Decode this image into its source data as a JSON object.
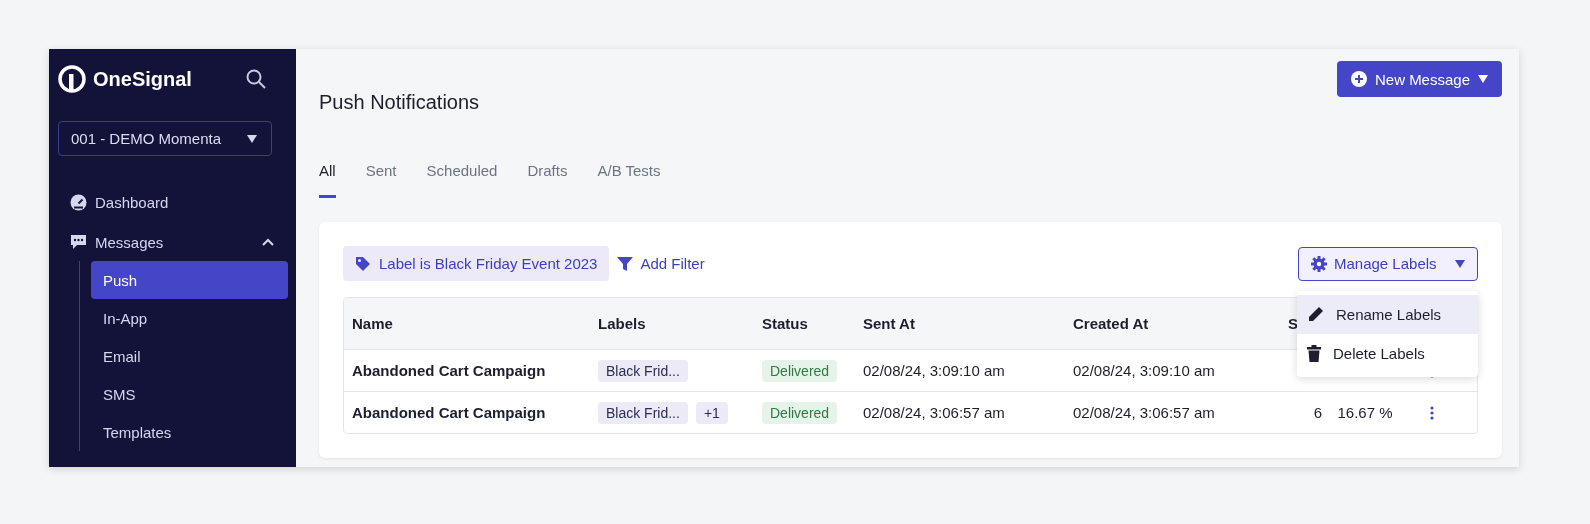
{
  "sidebar": {
    "brand": "OneSignal",
    "app_selector": "001 - DEMO Momenta",
    "nav": [
      {
        "label": "Dashboard"
      },
      {
        "label": "Messages",
        "expanded": true,
        "children": [
          {
            "label": "Push",
            "selected": true
          },
          {
            "label": "In-App",
            "selected": false
          },
          {
            "label": "Email",
            "selected": false
          },
          {
            "label": "SMS",
            "selected": false
          },
          {
            "label": "Templates",
            "selected": false
          }
        ]
      }
    ]
  },
  "header": {
    "title": "Push Notifications",
    "new_button": "New Message"
  },
  "tabs": [
    {
      "label": "All",
      "selected": true
    },
    {
      "label": "Sent",
      "selected": false
    },
    {
      "label": "Scheduled",
      "selected": false
    },
    {
      "label": "Drafts",
      "selected": false
    },
    {
      "label": "A/B Tests",
      "selected": false
    }
  ],
  "filters": {
    "active": "Label is Black Friday Event 2023",
    "add": "Add Filter"
  },
  "manage_labels": {
    "label": "Manage Labels",
    "expanded": true,
    "menu": [
      {
        "label": "Rename Labels",
        "selected": true
      },
      {
        "label": "Delete Labels",
        "selected": false
      }
    ]
  },
  "table": {
    "columns": [
      "Name",
      "Labels",
      "Status",
      "Sent At",
      "Created At",
      "S"
    ],
    "rows": [
      {
        "name": "Abandoned Cart Campaign",
        "labels": [
          "Black Frid..."
        ],
        "status": "Delivered",
        "sent_at": "02/08/24, 3:09:10 am",
        "created_at": "02/08/24, 3:09:10 am"
      },
      {
        "name": "Abandoned Cart Campaign",
        "labels": [
          "Black Frid...",
          "+1"
        ],
        "status": "Delivered",
        "sent_at": "02/08/24, 3:06:57 am",
        "created_at": "02/08/24, 3:06:57 am",
        "count": "6",
        "rate": "16.67 %"
      }
    ]
  }
}
